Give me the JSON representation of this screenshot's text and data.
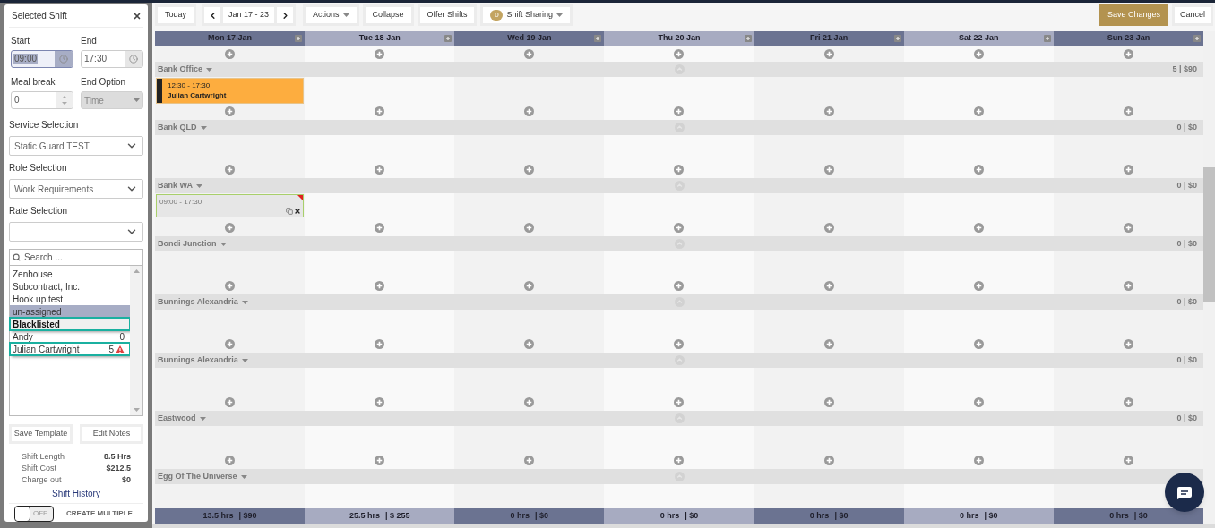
{
  "sidebar": {
    "title": "Selected Shift",
    "fields": [
      {
        "label": "Start",
        "value": "09:00",
        "focused": true,
        "kind": "time"
      },
      {
        "label": "End",
        "value": "17:30",
        "focused": false,
        "kind": "time"
      },
      {
        "label": "Meal break",
        "value": "0",
        "kind": "number"
      },
      {
        "label": "End Option",
        "value": "Time",
        "kind": "select",
        "disabled": true
      }
    ],
    "selects": [
      {
        "label": "Service Selection",
        "value": "Static Guard TEST"
      },
      {
        "label": "Role Selection",
        "value": "Work Requirements"
      },
      {
        "label": "Rate Selection"
      }
    ],
    "search": {
      "placeholder": "Search ..."
    },
    "list": [
      {
        "kind": "item",
        "name": "Zenhouse",
        "selected": false,
        "annotated": false
      },
      {
        "kind": "item",
        "name": "Subcontract, Inc.",
        "selected": false,
        "annotated": false
      },
      {
        "kind": "item",
        "name": "Hook up test",
        "selected": false,
        "annotated": false
      },
      {
        "kind": "item",
        "name": "un-assigned",
        "selected": true,
        "annotated": false
      },
      {
        "kind": "group",
        "name": "Blacklisted",
        "annotated": true
      },
      {
        "kind": "item",
        "name": "Andy",
        "count": "0",
        "warning": false,
        "selected": false,
        "annotated": false
      },
      {
        "kind": "item",
        "name": "Julian Cartwright",
        "count": "5",
        "warning": true,
        "selected": false,
        "annotated": true
      }
    ],
    "buttons": [
      "Save Template",
      "Edit Notes"
    ],
    "stats": [
      {
        "label": "Shift Length",
        "value": "8.5 Hrs"
      },
      {
        "label": "Shift Cost",
        "value": "$212.5"
      },
      {
        "label": "Charge out",
        "value": "$0"
      }
    ],
    "history_link": "Shift History",
    "toggle": {
      "on": false,
      "off_text": "OFF",
      "label": "CREATE MULTIPLE"
    }
  },
  "toolbar": {
    "today": "Today",
    "range": "Jan 17 - 23",
    "actions": "Actions",
    "collapse": "Collapse",
    "offer": "Offer Shifts",
    "sharing": {
      "count": "0",
      "label": "Shift Sharing"
    },
    "save": "Save Changes",
    "cancel": "Cancel"
  },
  "days": [
    "Mon 17 Jan",
    "Tue 18 Jan",
    "Wed 19 Jan",
    "Thu 20 Jan",
    "Fri 21 Jan",
    "Sat 22 Jan",
    "Sun 23 Jan"
  ],
  "groups": [
    {
      "name": "Bank Office",
      "total": "5 | $90",
      "cells": [
        {
          "kind": "assigned",
          "time": "12:30 - 17:30",
          "name": "Julian Cartwright"
        },
        {
          "kind": "empty"
        },
        {
          "kind": "empty"
        },
        {
          "kind": "empty"
        },
        {
          "kind": "empty"
        },
        {
          "kind": "empty"
        },
        {
          "kind": "empty"
        }
      ]
    },
    {
      "name": "Bank QLD",
      "total": "0 | $0"
    },
    {
      "name": "Bank WA",
      "total": "0 | $0",
      "cells": [
        {
          "kind": "open",
          "time": "09:00 - 17:30"
        },
        {
          "kind": "empty"
        },
        {
          "kind": "empty"
        },
        {
          "kind": "empty"
        },
        {
          "kind": "empty"
        },
        {
          "kind": "empty"
        },
        {
          "kind": "empty"
        }
      ]
    },
    {
      "name": "Bondi Junction",
      "total": "0 | $0"
    },
    {
      "name": "Bunnings Alexandria",
      "total": "0 | $0"
    },
    {
      "name": "Bunnings Alexandria",
      "total": "0 | $0"
    },
    {
      "name": "Eastwood",
      "total": "0 | $0"
    },
    {
      "name": "Egg Of The Universe"
    }
  ],
  "footer": [
    {
      "hours": "13.5 hrs",
      "cost": "| $90"
    },
    {
      "hours": "25.5 hrs",
      "cost": "| $ 255"
    },
    {
      "hours": "0 hrs",
      "cost": "| $0"
    },
    {
      "hours": "0 hrs",
      "cost": "| $0"
    },
    {
      "hours": "0 hrs",
      "cost": "| $0"
    },
    {
      "hours": "0 hrs",
      "cost": "| $0"
    },
    {
      "hours": "0 hrs",
      "cost": "| $0"
    }
  ]
}
